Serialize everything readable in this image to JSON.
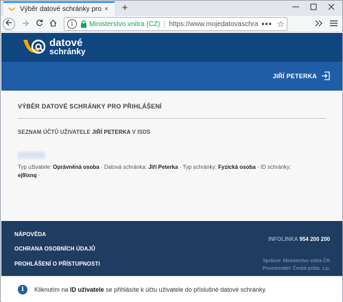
{
  "browser": {
    "tab_title": "Výběr datové schránky pro přihlášení",
    "tab_close": "×",
    "new_tab": "+",
    "url_info": "i",
    "url_org": "Ministerstvo vnitra (CZ)",
    "url_text": "https://www.mojedatovaschra",
    "url_more": "•••",
    "url_star": "☆"
  },
  "header": {
    "logo_line1": "datové",
    "logo_line2": "schránky",
    "user_name": "JIŘÍ PETERKA"
  },
  "main": {
    "title": "VÝBĚR DATOVÉ SCHRÁNKY PRO PŘIHLÁŠENÍ",
    "list_title_prefix": "SEZNAM ÚČTŮ UŽIVATELE ",
    "list_title_name": "JIŘÍ PETERKA",
    "list_title_suffix": " V ISDS",
    "account": {
      "l_user_type": "Typ uživatele: ",
      "v_user_type": "Oprávněná osoba",
      "l_box": " · Datová schránka: ",
      "v_box": "Jiří Peterka",
      "l_box_type": " · Typ schránky: ",
      "v_box_type": "Fyzická osoba",
      "l_box_id": " · ID schránky: ",
      "v_box_id": "ej9ixnq",
      "tail": " ·"
    }
  },
  "footer": {
    "links": [
      "NÁPOVĚDA",
      "OCHRANA OSOBNÍCH ÚDAJŮ",
      "PROHLÁŠENÍ O PŘÍSTUPNOSTI"
    ],
    "infolinka_label": "INFOLINKA ",
    "infolinka_number": "954 200 200",
    "spravce": "Správce: Ministerstvo vnitra ČR",
    "provozovatel": "Provozovatel: Česká pošta, s.p."
  },
  "notice": {
    "icon": "i",
    "pre": "Kliknutím na ",
    "bold": "ID uživatele",
    "post": " se přihlásíte k účtu uživatele do příslušné datové schránky."
  },
  "colors": {
    "header": "#104680",
    "user_bar": "#1f5da6",
    "footer": "#1e3d60",
    "logo_orange": "#f6a800",
    "secure_green": "#12a35c"
  }
}
